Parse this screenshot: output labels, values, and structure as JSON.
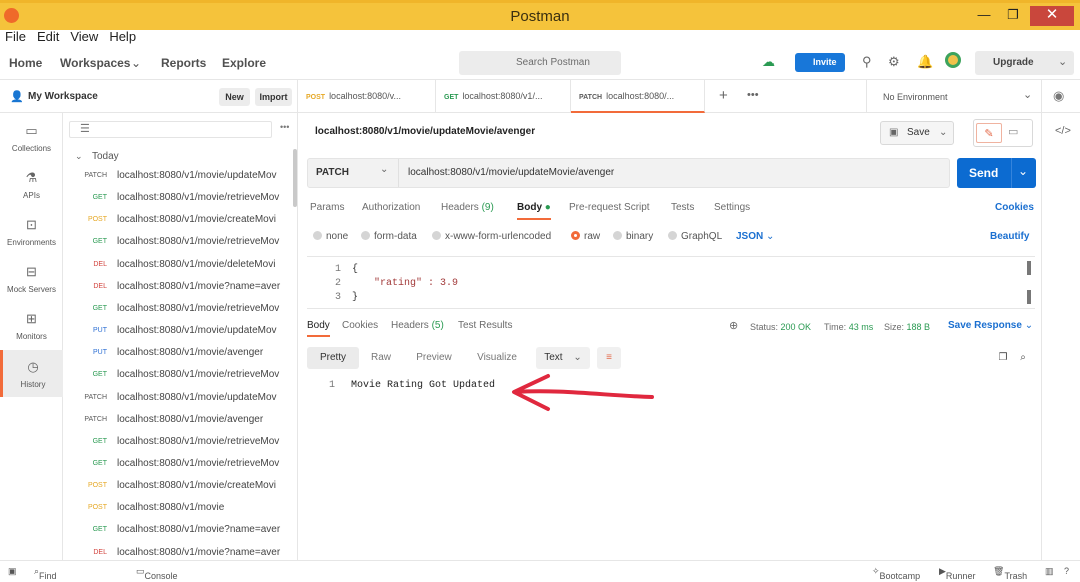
{
  "window": {
    "title": "Postman",
    "minimize": "—",
    "maximize": "❐",
    "close": "✕"
  },
  "menu": [
    "File",
    "Edit",
    "View",
    "Help"
  ],
  "header": {
    "nav": [
      "Home",
      "Workspaces",
      "Reports",
      "Explore"
    ],
    "search_placeholder": "Search Postman",
    "invite": "Invite",
    "upgrade": "Upgrade"
  },
  "workspace": {
    "name": "My Workspace",
    "new_label": "New",
    "import_label": "Import"
  },
  "tabs": [
    {
      "method": "POST",
      "url": "localhost:8080/v..."
    },
    {
      "method": "GET",
      "url": "localhost:8080/v1/..."
    },
    {
      "method": "PATCH",
      "url": "localhost:8080/..."
    }
  ],
  "environment": "No Environment",
  "sidebar": [
    "Collections",
    "APIs",
    "Environments",
    "Mock Servers",
    "Monitors",
    "History"
  ],
  "history": {
    "group": "Today",
    "items": [
      {
        "method": "PATCH",
        "url": "localhost:8080/v1/movie/updateMov"
      },
      {
        "method": "GET",
        "url": "localhost:8080/v1/movie/retrieveMov"
      },
      {
        "method": "POST",
        "url": "localhost:8080/v1/movie/createMovi"
      },
      {
        "method": "GET",
        "url": "localhost:8080/v1/movie/retrieveMov"
      },
      {
        "method": "DEL",
        "url": "localhost:8080/v1/movie/deleteMovi"
      },
      {
        "method": "DEL",
        "url": "localhost:8080/v1/movie?name=aver"
      },
      {
        "method": "GET",
        "url": "localhost:8080/v1/movie/retrieveMov"
      },
      {
        "method": "PUT",
        "url": "localhost:8080/v1/movie/updateMov"
      },
      {
        "method": "PUT",
        "url": "localhost:8080/v1/movie/avenger"
      },
      {
        "method": "GET",
        "url": "localhost:8080/v1/movie/retrieveMov"
      },
      {
        "method": "PATCH",
        "url": "localhost:8080/v1/movie/updateMov"
      },
      {
        "method": "PATCH",
        "url": "localhost:8080/v1/movie/avenger"
      },
      {
        "method": "GET",
        "url": "localhost:8080/v1/movie/retrieveMov"
      },
      {
        "method": "GET",
        "url": "localhost:8080/v1/movie/retrieveMov"
      },
      {
        "method": "POST",
        "url": "localhost:8080/v1/movie/createMovi"
      },
      {
        "method": "POST",
        "url": "localhost:8080/v1/movie"
      },
      {
        "method": "GET",
        "url": "localhost:8080/v1/movie?name=aver"
      },
      {
        "method": "DEL",
        "url": "localhost:8080/v1/movie?name=aver"
      }
    ]
  },
  "request": {
    "name": "localhost:8080/v1/movie/updateMovie/avenger",
    "save": "Save",
    "method": "PATCH",
    "url": "localhost:8080/v1/movie/updateMovie/avenger",
    "send": "Send",
    "tabs": [
      "Params",
      "Authorization",
      "Headers",
      "Body",
      "Pre-request Script",
      "Tests",
      "Settings"
    ],
    "headers_count": "(9)",
    "cookies": "Cookies",
    "body_types": [
      "none",
      "form-data",
      "x-www-form-urlencoded",
      "raw",
      "binary",
      "GraphQL"
    ],
    "body_format": "JSON",
    "beautify": "Beautify",
    "body_lines": [
      "{",
      "\"rating\" : 3.9",
      "}"
    ],
    "line_numbers": [
      "1",
      "2",
      "3"
    ]
  },
  "response": {
    "tabs": [
      "Body",
      "Cookies",
      "Headers",
      "Test Results"
    ],
    "headers_count": "(5)",
    "status_label": "Status:",
    "status_value": "200 OK",
    "time_label": "Time:",
    "time_value": "43 ms",
    "size_label": "Size:",
    "size_value": "188 B",
    "save_response": "Save Response",
    "views": [
      "Pretty",
      "Raw",
      "Preview",
      "Visualize"
    ],
    "format": "Text",
    "line_number": "1",
    "body": "Movie Rating Got Updated",
    "annotation_color": "#e0283e"
  },
  "statusbar": {
    "find_replace": "Find and Replace",
    "console": "Console",
    "bootcamp": "Bootcamp",
    "runner": "Runner",
    "trash": "Trash"
  },
  "colors": {
    "titlebar": "#f5c33b",
    "send": "#0c6bd1",
    "history_accent": "#f26b3a"
  }
}
